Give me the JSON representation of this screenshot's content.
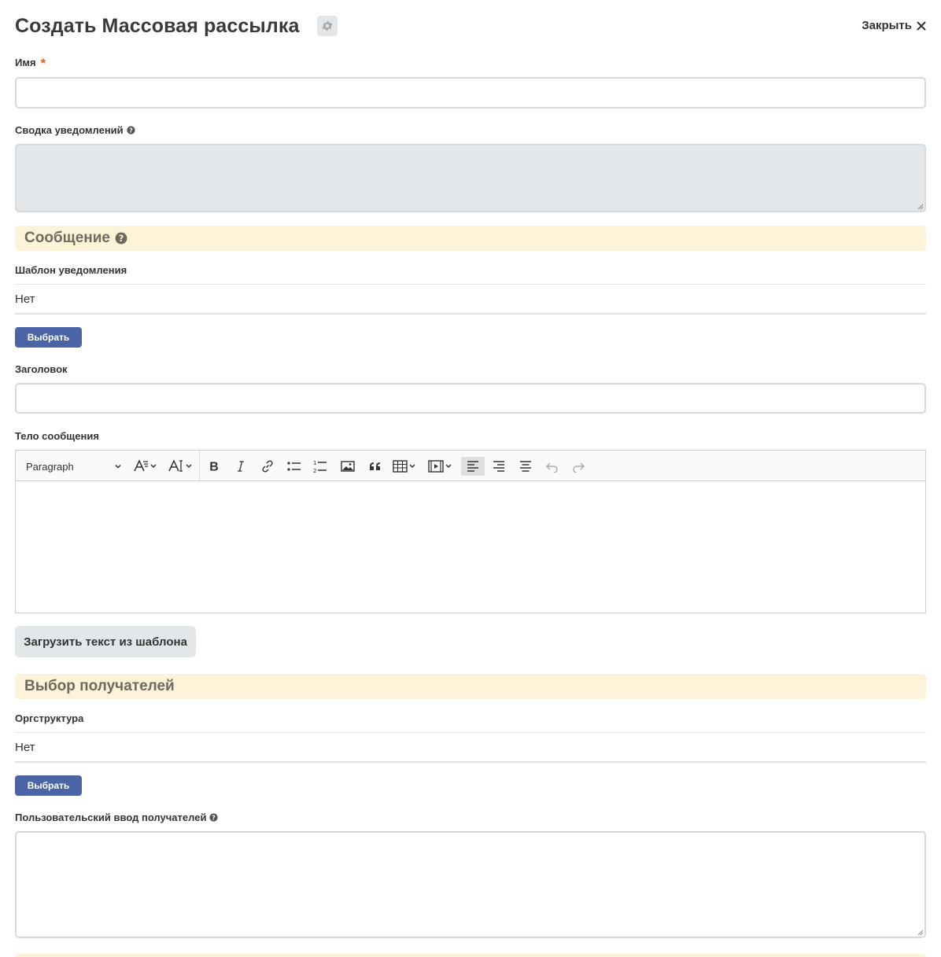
{
  "header": {
    "title": "Создать Массовая рассылка",
    "close_label": "Закрыть"
  },
  "fields": {
    "name_label": "Имя",
    "summary_label": "Сводка уведомлений",
    "template_label": "Шаблон уведомления",
    "template_value": "Нет",
    "subject_label": "Заголовок",
    "body_label": "Тело сообщения",
    "orgstructure_label": "Оргструктура",
    "orgstructure_value": "Нет",
    "custom_recipients_label": "Пользовательский ввод получателей"
  },
  "sections": {
    "message": "Сообщение",
    "recipients": "Выбор получателей"
  },
  "buttons": {
    "select_template": "Выбрать",
    "select_org": "Выбрать",
    "load_template": "Загрузить текст из шаблона"
  },
  "editor": {
    "paragraph_select": "Paragraph",
    "tools": [
      "font-family",
      "font-size",
      "bold",
      "italic",
      "link",
      "bulleted-list",
      "numbered-list",
      "image",
      "blockquote",
      "table",
      "media",
      "align-left",
      "align-right",
      "align-center",
      "undo",
      "redo"
    ]
  },
  "colors": {
    "primary_button": "#4b64a6",
    "section_band": "#fdf3d8",
    "required_star": "#e8601c"
  }
}
